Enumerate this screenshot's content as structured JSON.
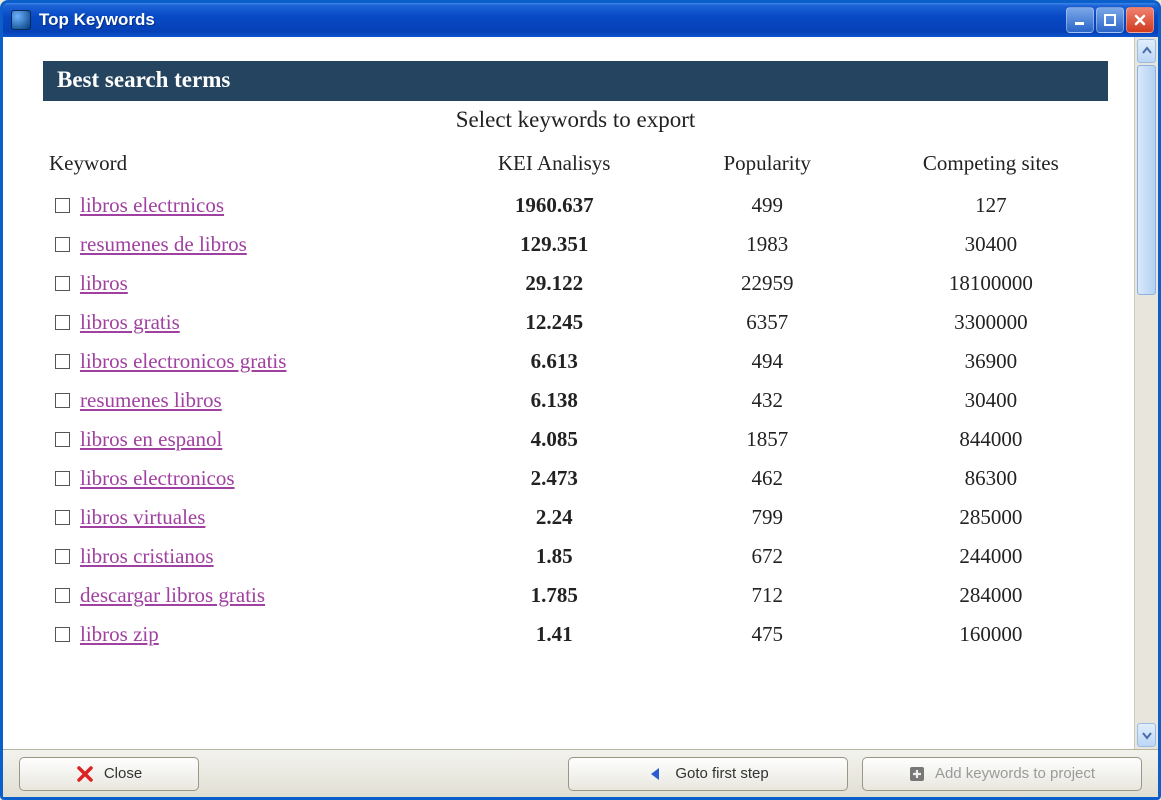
{
  "window": {
    "title": "Top Keywords"
  },
  "section": {
    "header": "Best search terms",
    "subtitle": "Select keywords to export"
  },
  "columns": {
    "keyword": "Keyword",
    "kei": "KEI Analisys",
    "popularity": "Popularity",
    "competing": "Competing sites"
  },
  "rows": [
    {
      "keyword": " libros electrnicos",
      "kei": "1960.637",
      "popularity": "499",
      "competing": "127"
    },
    {
      "keyword": " resumenes de libros",
      "kei": "129.351",
      "popularity": "1983",
      "competing": "30400"
    },
    {
      "keyword": " libros",
      "kei": "29.122",
      "popularity": "22959",
      "competing": "18100000"
    },
    {
      "keyword": " libros gratis",
      "kei": "12.245",
      "popularity": "6357",
      "competing": "3300000"
    },
    {
      "keyword": " libros electronicos gratis",
      "kei": "6.613",
      "popularity": "494",
      "competing": "36900"
    },
    {
      "keyword": " resumenes libros",
      "kei": "6.138",
      "popularity": "432",
      "competing": "30400"
    },
    {
      "keyword": " libros en espanol",
      "kei": "4.085",
      "popularity": "1857",
      "competing": "844000"
    },
    {
      "keyword": " libros electronicos",
      "kei": "2.473",
      "popularity": "462",
      "competing": "86300"
    },
    {
      "keyword": " libros virtuales",
      "kei": "2.24",
      "popularity": "799",
      "competing": "285000"
    },
    {
      "keyword": " libros cristianos",
      "kei": "1.85",
      "popularity": "672",
      "competing": "244000"
    },
    {
      "keyword": " descargar libros gratis",
      "kei": "1.785",
      "popularity": "712",
      "competing": "284000"
    },
    {
      "keyword": " libros zip",
      "kei": "1.41",
      "popularity": "475",
      "competing": "160000"
    }
  ],
  "footer": {
    "close": "Close",
    "goto_first": "Goto first step",
    "add_to_project": "Add keywords to project"
  }
}
